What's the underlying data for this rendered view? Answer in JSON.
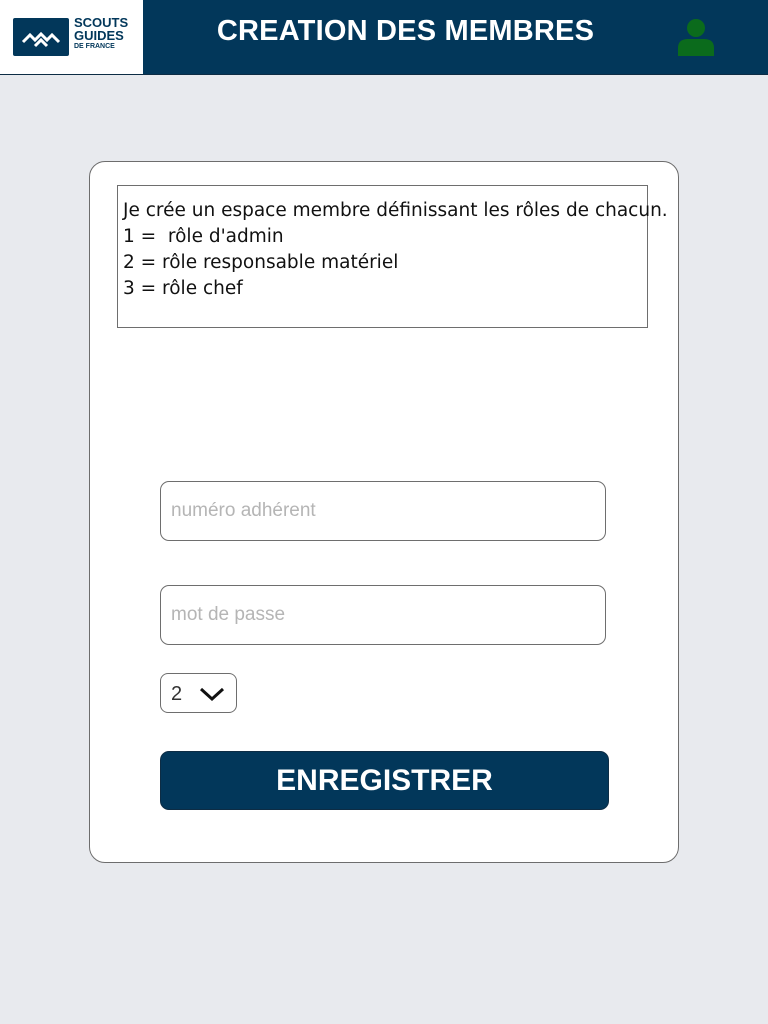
{
  "header": {
    "title": "CREATION DES MEMBRES",
    "logo": {
      "line1": "SCOUTS",
      "line2": "GUIDES",
      "line3": "DE FRANCE"
    },
    "user_icon": "user-icon",
    "colors": {
      "bar": "#02375a",
      "user_icon": "#0b6b1c"
    }
  },
  "form": {
    "description_lines": [
      "Je crée un espace membre définissant les rôles de chacun.",
      "1 =  rôle d'admin",
      "2 = rôle responsable matériel",
      "3 = rôle chef"
    ],
    "member_number": {
      "placeholder": "numéro adhérent",
      "value": ""
    },
    "password": {
      "placeholder": "mot de passe",
      "value": ""
    },
    "role_select": {
      "value": "2"
    },
    "submit_label": "ENREGISTRER"
  }
}
